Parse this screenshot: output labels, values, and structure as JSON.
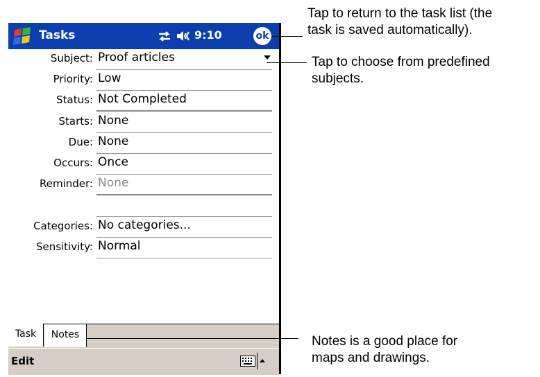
{
  "titlebar": {
    "app_title": "Tasks",
    "time": "9:10",
    "ok_label": "ok"
  },
  "fields": [
    {
      "label": "Subject:",
      "value": "Proof articles"
    },
    {
      "label": "Priority:",
      "value": "Low"
    },
    {
      "label": "Status:",
      "value": "Not Completed"
    },
    {
      "label": "Starts:",
      "value": "None"
    },
    {
      "label": "Due:",
      "value": "None"
    },
    {
      "label": "Occurs:",
      "value": "Once"
    },
    {
      "label": "Reminder:",
      "value": "None"
    },
    {
      "label": "Categories:",
      "value": "No categories..."
    },
    {
      "label": "Sensitivity:",
      "value": "Normal"
    }
  ],
  "tabs": {
    "task": "Task",
    "notes": "Notes"
  },
  "menubar": {
    "edit": "Edit"
  },
  "callouts": {
    "ok_line1": "Tap to return to the task list (the",
    "ok_line2": "task is saved automatically).",
    "subject_line1": "Tap to choose from predefined",
    "subject_line2": "subjects.",
    "notes_line1": "Notes is a good place for",
    "notes_line2": "maps and drawings."
  }
}
